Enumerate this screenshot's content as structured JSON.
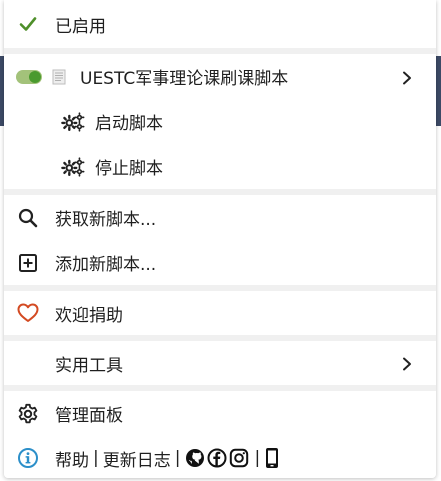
{
  "enabled": {
    "label": "已启用"
  },
  "script": {
    "name": "UESTC军事理论课刷课脚本",
    "commands": [
      {
        "label": "启动脚本"
      },
      {
        "label": "停止脚本"
      }
    ]
  },
  "actions": {
    "get_scripts": "获取新脚本...",
    "add_script": "添加新脚本..."
  },
  "donate": {
    "label": "欢迎捐助"
  },
  "tools": {
    "label": "实用工具"
  },
  "dashboard": {
    "label": "管理面板"
  },
  "footer": {
    "help": "帮助",
    "changelog": "更新日志",
    "separator": "|",
    "icons": [
      "github-icon",
      "facebook-icon",
      "instagram-icon",
      "mobile-icon"
    ]
  },
  "colors": {
    "check": "#4e8f2a",
    "toggle_on": "#4a9a2e",
    "heart": "#d34a22",
    "info": "#2c8fc9"
  },
  "icons": {
    "enabled": "check-icon",
    "command": "gears-icon",
    "search": "search-icon",
    "add": "plus-square-icon",
    "donate": "heart-icon",
    "dashboard": "gear-icon",
    "help": "info-icon",
    "submenu": "chevron-right-icon"
  }
}
